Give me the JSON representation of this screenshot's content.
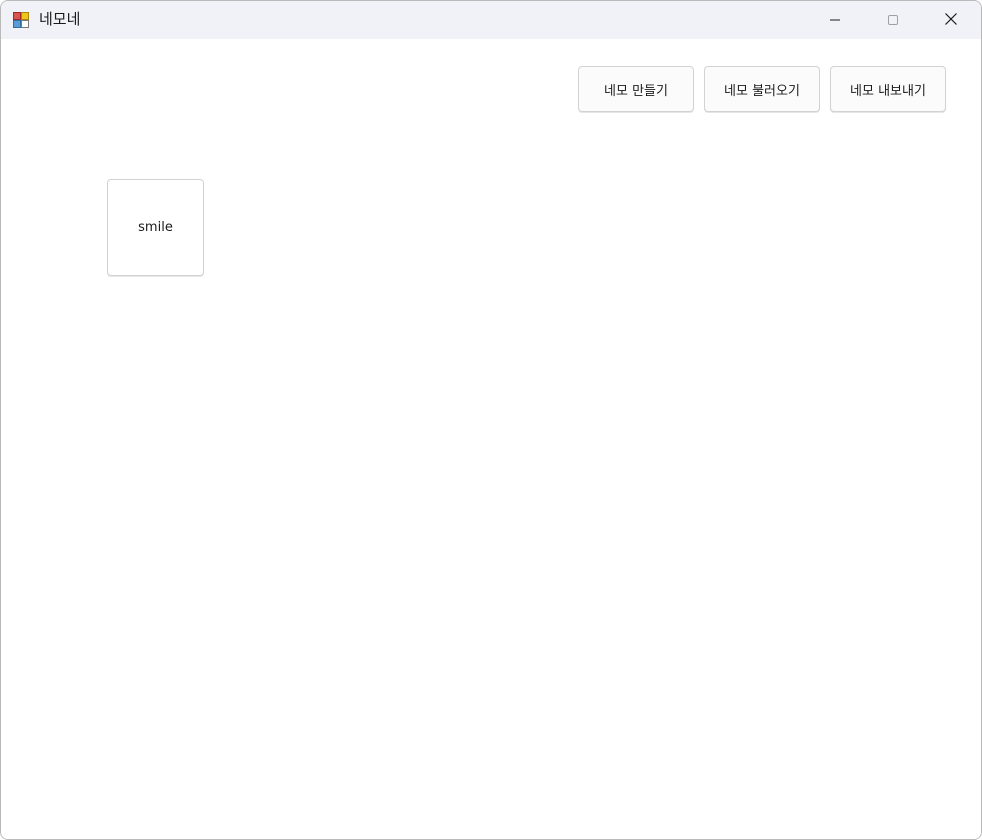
{
  "window": {
    "title": "네모네",
    "app_icon": "app-icon",
    "controls": {
      "minimize_icon": "minimize-icon",
      "maximize_icon": "maximize-icon",
      "close_icon": "close-icon"
    }
  },
  "toolbar": {
    "create_label": "네모 만들기",
    "load_label": "네모 불러오기",
    "export_label": "네모 내보내기"
  },
  "canvas": {
    "nemos": [
      {
        "label": "smile"
      }
    ]
  }
}
